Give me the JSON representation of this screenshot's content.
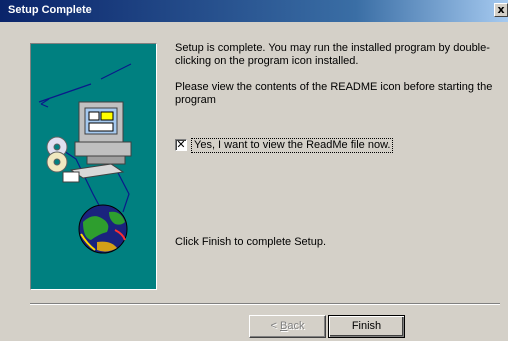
{
  "window": {
    "title": "Setup Complete",
    "close_glyph": "x"
  },
  "content": {
    "message_complete": "Setup is complete.  You may run the installed program by double-clicking on the program icon installed.",
    "message_readme": "Please view the contents of the README icon before starting the program",
    "checkbox": {
      "checked": true,
      "label": "Yes, I want to view the ReadMe file now."
    },
    "message_finish": "Click Finish to complete Setup."
  },
  "buttons": {
    "back_prefix": "< ",
    "back_accel": "B",
    "back_rest": "ack",
    "finish_label": "Finish"
  },
  "colors": {
    "panel": "#008080",
    "title_start": "#0a246a",
    "title_end": "#a6caf0"
  },
  "icons": [
    "computer-icon",
    "cd-disc-icon",
    "globe-icon",
    "close-icon"
  ]
}
